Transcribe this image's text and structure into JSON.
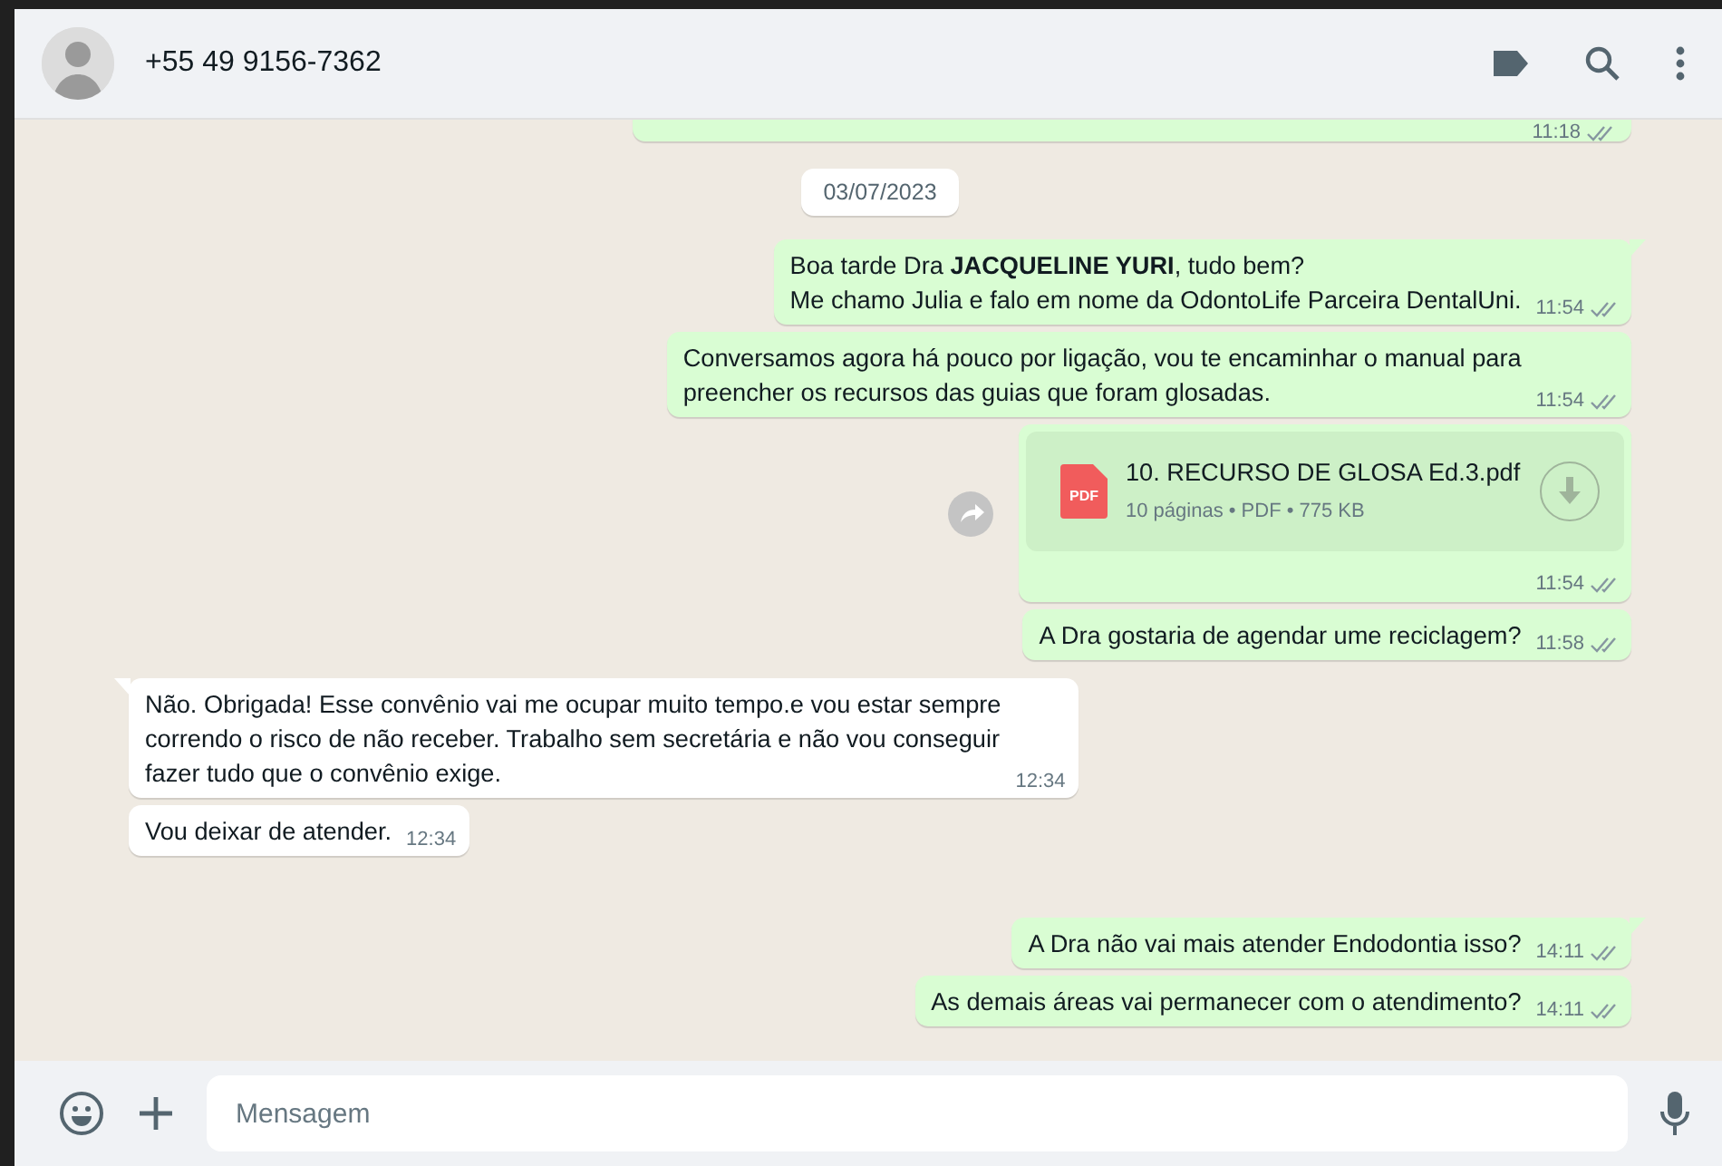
{
  "header": {
    "contact": "+55 49 9156-7362"
  },
  "messages": [
    {
      "kind": "partial",
      "outgoing": true,
      "time": "11:18",
      "delivered": true
    },
    {
      "kind": "date",
      "text": "03/07/2023"
    },
    {
      "kind": "text",
      "outgoing": true,
      "tail": true,
      "lines": [
        "Boa tarde Dra **JACQUELINE YURI**, tudo bem?",
        "Me chamo Julia e falo em nome da OdontoLife Parceira DentalUni."
      ],
      "time": "11:54",
      "delivered": true
    },
    {
      "kind": "text",
      "outgoing": true,
      "tail": false,
      "lines": [
        "Conversamos agora há pouco por ligação, vou te encaminhar o manual para",
        "preencher os recursos das guias que foram glosadas."
      ],
      "time": "11:54",
      "delivered": true
    },
    {
      "kind": "document",
      "outgoing": true,
      "tail": false,
      "file_type": "PDF",
      "file_name": "10. RECURSO DE GLOSA Ed.3.pdf",
      "details": "10 páginas • PDF • 775 KB",
      "time": "11:54",
      "delivered": true
    },
    {
      "kind": "text",
      "outgoing": true,
      "tail": false,
      "lines": [
        "A Dra gostaria de agendar ume reciclagem?"
      ],
      "time": "11:58",
      "delivered": true
    },
    {
      "kind": "text",
      "outgoing": false,
      "tail": true,
      "lines": [
        "Não. Obrigada! Esse convênio vai me ocupar muito tempo.e vou estar sempre",
        "correndo o risco de não receber. Trabalho sem secretária e não vou conseguir",
        "fazer tudo que o convênio exige."
      ],
      "time": "12:34"
    },
    {
      "kind": "text",
      "outgoing": false,
      "tail": false,
      "lines": [
        "Vou deixar de atender."
      ],
      "time": "12:34"
    },
    {
      "kind": "gap"
    },
    {
      "kind": "text",
      "outgoing": true,
      "tail": true,
      "lines": [
        "A Dra não vai mais atender Endodontia isso?"
      ],
      "time": "14:11",
      "delivered": true
    },
    {
      "kind": "text",
      "outgoing": true,
      "tail": false,
      "lines": [
        "As demais áreas vai permanecer com o atendimento?"
      ],
      "time": "14:11",
      "delivered": true
    }
  ],
  "composer": {
    "placeholder": "Mensagem"
  }
}
